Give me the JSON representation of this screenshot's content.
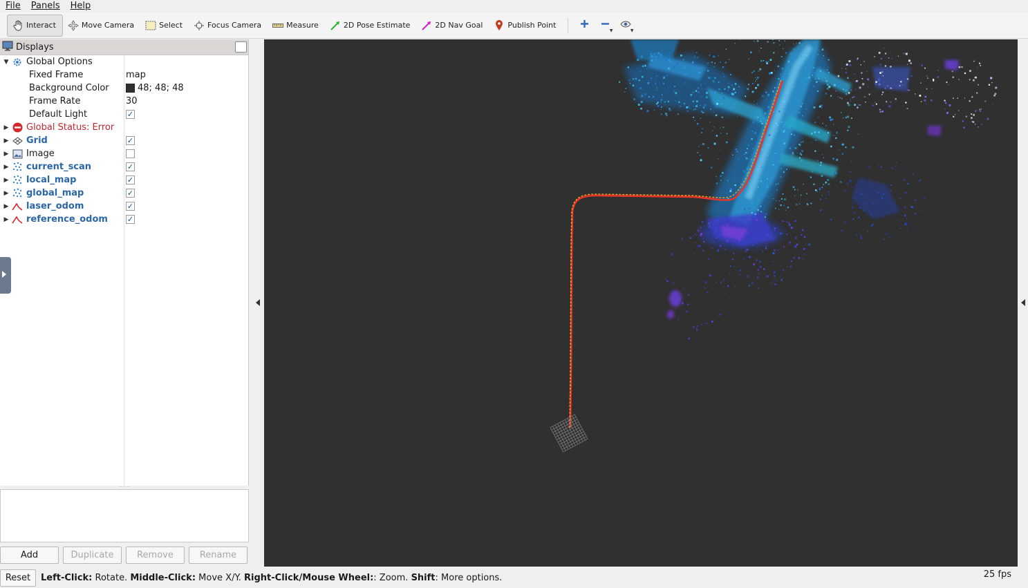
{
  "menu": {
    "file": "File",
    "panels": "Panels",
    "help": "Help"
  },
  "toolbar": {
    "interact": "Interact",
    "move_camera": "Move Camera",
    "select": "Select",
    "focus_camera": "Focus Camera",
    "measure": "Measure",
    "pose_estimate": "2D Pose Estimate",
    "nav_goal": "2D Nav Goal",
    "publish_point": "Publish Point"
  },
  "displays": {
    "title": "Displays",
    "global_options": {
      "label": "Global Options",
      "fixed_frame_label": "Fixed Frame",
      "fixed_frame_value": "map",
      "background_color_label": "Background Color",
      "background_color_value": "48; 48; 48",
      "background_color_hex": "#303030",
      "frame_rate_label": "Frame Rate",
      "frame_rate_value": "30",
      "default_light_label": "Default Light",
      "default_light_checked": true
    },
    "global_status": "Global Status: Error",
    "items": [
      {
        "label": "Grid",
        "checked": true,
        "icon": "grid-icon",
        "bold": true
      },
      {
        "label": "Image",
        "checked": false,
        "icon": "image-icon",
        "bold": false
      },
      {
        "label": "current_scan",
        "checked": true,
        "icon": "pointcloud-icon",
        "bold": true
      },
      {
        "label": "local_map",
        "checked": true,
        "icon": "pointcloud-icon",
        "bold": true
      },
      {
        "label": "global_map",
        "checked": true,
        "icon": "pointcloud-icon",
        "bold": true
      },
      {
        "label": "laser_odom",
        "checked": true,
        "icon": "odometry-icon",
        "bold": true
      },
      {
        "label": "reference_odom",
        "checked": true,
        "icon": "odometry-icon",
        "bold": true
      }
    ]
  },
  "buttons": {
    "add": "Add",
    "duplicate": "Duplicate",
    "remove": "Remove",
    "rename": "Rename"
  },
  "status": {
    "reset": "Reset",
    "left_click_key": "Left-Click:",
    "left_click_text": " Rotate. ",
    "middle_click_key": "Middle-Click:",
    "middle_click_text": " Move X/Y. ",
    "right_click_key": "Right-Click/Mouse Wheel:",
    "right_click_text": ": Zoom. ",
    "shift_key": "Shift",
    "shift_text": ": More options.",
    "fps": "25 fps"
  },
  "colors": {
    "accent": "#2a66a8",
    "error": "#c4262e",
    "viewport_bg": "#303030"
  }
}
